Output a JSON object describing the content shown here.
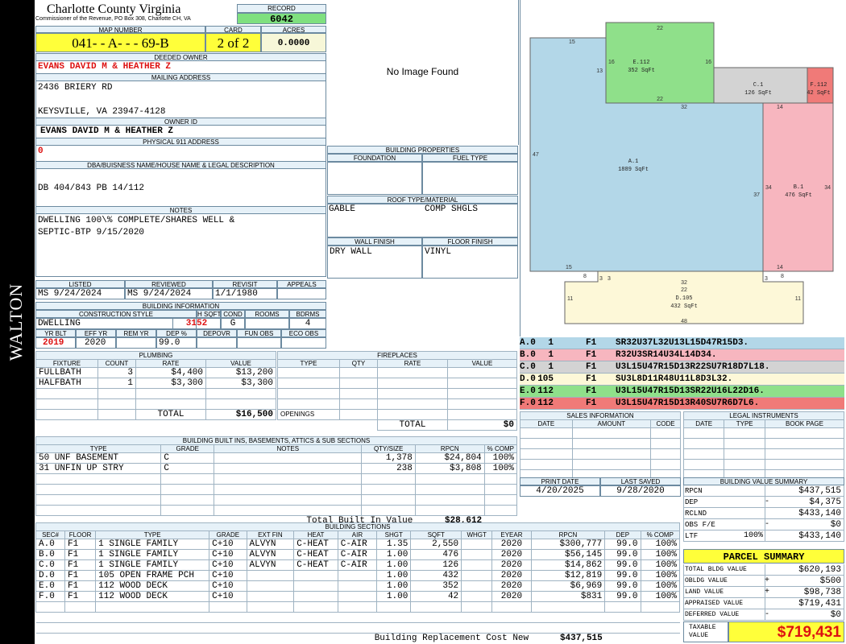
{
  "sidebar": {
    "district": "WALTON"
  },
  "header": {
    "county_title": "Charlotte County Virginia",
    "county_sub": "Commissioner of the Revenue, PO Box 308, Charlotte CH, VA",
    "record_label": "RECORD",
    "record_value": "6042",
    "map_label": "MAP NUMBER",
    "map_value": "041- - A- - - 69-B",
    "card_label": "CARD",
    "card_value": "2 of 2",
    "acres_label": "ACRES",
    "acres_value": "0.0000"
  },
  "owner": {
    "deeded_label": "DEEDED OWNER",
    "deeded_value": "EVANS DAVID M & HEATHER Z",
    "mailing_label": "MAILING ADDRESS",
    "mailing_line1": "2436 BRIERY RD",
    "mailing_line2": "KEYSVILLE, VA 23947-4128",
    "owner_id_label": "OWNER ID",
    "owner_id_value": "EVANS DAVID M & HEATHER Z",
    "physical_label": "PHYSICAL 911 ADDRESS",
    "physical_value": "0",
    "dba_label": "DBA/BUISNESS NAME/HOUSE NAME & LEGAL DESCRIPTION",
    "dba_value": "DB 404/843 PB 14/112",
    "notes_label": "NOTES",
    "notes_line1": "DWELLING 100\\% COMPLETE/SHARES WELL &",
    "notes_line2": "SEPTIC-BTP 9/15/2020"
  },
  "image": {
    "placeholder": "No Image Found"
  },
  "building_properties": {
    "title": "BUILDING PROPERTIES",
    "foundation_label": "FOUNDATION",
    "foundation_value": "",
    "fuel_label": "FUEL TYPE",
    "fuel_value": "",
    "roof_label": "ROOF TYPE/MATERIAL",
    "roof_type": "GABLE",
    "roof_material": "COMP SHGLS",
    "wall_label": "WALL FINISH",
    "wall_value": "DRY WALL",
    "floor_label": "FLOOR FINISH",
    "floor_value": "VINYL"
  },
  "dates": {
    "listed_label": "LISTED",
    "listed_value": "MS 9/24/2024",
    "reviewed_label": "REVIEWED",
    "reviewed_value": "MS 9/24/2024",
    "revisit_label": "REVISIT",
    "revisit_value": "1/1/1980",
    "appeals_label": "APPEALS",
    "appeals_value": ""
  },
  "building_info": {
    "title": "BUILDING INFORMATION",
    "style_label": "CONSTRUCTION STYLE",
    "style_value": "DWELLING",
    "hsqft_label": "H SQFT",
    "hsqft_value": "3152",
    "cond_label": "COND",
    "cond_value": "G",
    "rooms_label": "ROOMS",
    "rooms_value": "",
    "bdrms_label": "BDRMS",
    "bdrms_value": "4",
    "yrblt_label": "YR BLT",
    "yrblt_value": "2019",
    "effyr_label": "EFF YR",
    "effyr_value": "2020",
    "remyr_label": "REM YR",
    "remyr_value": "",
    "dep_label": "DEP %",
    "dep_value": "99.0",
    "depovr_label": "DEPOVR",
    "depovr_value": "",
    "funobs_label": "FUN OBS",
    "funobs_value": "",
    "ecoobs_label": "ECO OBS",
    "ecoobs_value": ""
  },
  "plumbing": {
    "title": "PLUMBING",
    "headers": [
      "FIXTURE",
      "COUNT",
      "RATE",
      "VALUE"
    ],
    "rows": [
      [
        "FULLBATH",
        "3",
        "$4,400",
        "$13,200"
      ],
      [
        "HALFBATH",
        "1",
        "$3,300",
        "$3,300"
      ]
    ],
    "total_label": "TOTAL",
    "total_value": "$16,500"
  },
  "fireplaces": {
    "title": "FIREPLACES",
    "headers": [
      "TYPE",
      "QTY",
      "RATE",
      "VALUE"
    ],
    "openings_label": "OPENINGS",
    "total_label": "TOTAL",
    "total_value": "$0"
  },
  "builtins": {
    "title": "BUILDING BUILT INS, BASEMENTS, ATTICS & SUB SECTIONS",
    "headers": [
      "TYPE",
      "GRADE",
      "NOTES",
      "QTY/SIZE",
      "RPCN",
      "% COMP"
    ],
    "rows": [
      [
        "50 UNF BASEMENT",
        "C",
        "",
        "1,378",
        "$24,804",
        "100%"
      ],
      [
        "31 UNFIN UP STRY",
        "C",
        "",
        "238",
        "$3,808",
        "100%"
      ]
    ],
    "total_label": "Total Built In Value",
    "total_value": "$28,612"
  },
  "sections": {
    "title": "BUILDING SECTIONS",
    "headers": [
      "SEC#",
      "FLOOR",
      "TYPE",
      "GRADE",
      "EXT FIN",
      "HEAT",
      "AIR",
      "SHGT",
      "SQFT",
      "WHGT",
      "EYEAR",
      "RPCN",
      "DEP",
      "% COMP"
    ],
    "rows": [
      [
        "A.0",
        "F1",
        "1 SINGLE FAMILY",
        "C+10",
        "ALVYN",
        "C-HEAT",
        "C-AIR",
        "1.35",
        "2,550",
        "",
        "2020",
        "$300,777",
        "99.0",
        "100%"
      ],
      [
        "B.0",
        "F1",
        "1 SINGLE FAMILY",
        "C+10",
        "ALVYN",
        "C-HEAT",
        "C-AIR",
        "1.00",
        "476",
        "",
        "2020",
        "$56,145",
        "99.0",
        "100%"
      ],
      [
        "C.0",
        "F1",
        "1 SINGLE FAMILY",
        "C+10",
        "ALVYN",
        "C-HEAT",
        "C-AIR",
        "1.00",
        "126",
        "",
        "2020",
        "$14,862",
        "99.0",
        "100%"
      ],
      [
        "D.0",
        "F1",
        "105 OPEN FRAME PCH",
        "C+10",
        "",
        "",
        "",
        "1.00",
        "432",
        "",
        "2020",
        "$12,819",
        "99.0",
        "100%"
      ],
      [
        "E.0",
        "F1",
        "112 WOOD DECK",
        "C+10",
        "",
        "",
        "",
        "1.00",
        "352",
        "",
        "2020",
        "$6,969",
        "99.0",
        "100%"
      ],
      [
        "F.0",
        "F1",
        "112 WOOD DECK",
        "C+10",
        "",
        "",
        "",
        "1.00",
        "42",
        "",
        "2020",
        "$831",
        "99.0",
        "100%"
      ]
    ],
    "replacement_label": "Building Replacement Cost New",
    "replacement_value": "$437,515"
  },
  "sketch": {
    "areas": [
      {
        "name": "A.1",
        "sqft": "1889 SqFt",
        "color": "#b3d7e8"
      },
      {
        "name": "B.1",
        "sqft": "476 SqFt",
        "color": "#f7b6bf"
      },
      {
        "name": "C.1",
        "sqft": "126 SqFt",
        "color": "#d3d3d3"
      },
      {
        "name": "D.105",
        "sqft": "432 SqFt",
        "color": "#fdf8d8"
      },
      {
        "name": "E.112",
        "sqft": "352 SqFt",
        "color": "#8fe08a"
      },
      {
        "name": "F.112",
        "sqft": "42 SqFt",
        "color": "#f07a78"
      }
    ],
    "dims": {
      "a_top": "15",
      "a_left": "47",
      "a_bottom": "15",
      "a_mid_bottom": "32",
      "a_right": "37",
      "e_top": "22",
      "e_left": "16",
      "e_right": "16",
      "e_bottom": "22",
      "e_left2": "13",
      "a_top_right": "32",
      "b_top": "14",
      "b_left": "34",
      "b_right": "34",
      "b_bottom": "14",
      "d_top": "32",
      "d_bottom": "48",
      "d_left": "11",
      "d_right": "11",
      "d_notch_l": "8",
      "d_notch_l2": "3",
      "d_notch_r": "3",
      "d_notch_r2": "8",
      "d_top2": "22"
    },
    "legend": [
      {
        "code": "A.0",
        "num": "1",
        "floor": "F1",
        "path": "SR32U37L32U13L15D47R15D3.",
        "color": "#b3d7e8"
      },
      {
        "code": "B.0",
        "num": "1",
        "floor": "F1",
        "path": "R32U3SR14U34L14D34.",
        "color": "#f7b6bf"
      },
      {
        "code": "C.0",
        "num": "1",
        "floor": "F1",
        "path": "U3L15U47R15D13R22SU7R18D7L18.",
        "color": "#d3d3d3"
      },
      {
        "code": "D.0",
        "num": "105",
        "floor": "F1",
        "path": "SU3L8D11R48U11L8D3L32.",
        "color": "#fdf8d8"
      },
      {
        "code": "E.0",
        "num": "112",
        "floor": "F1",
        "path": "U3L15U47R15D13SR22U16L22D16.",
        "color": "#8fe08a"
      },
      {
        "code": "F.0",
        "num": "112",
        "floor": "F1",
        "path": "U3L15U47R15D13R40SU7R6D7L6.",
        "color": "#f07a78"
      }
    ]
  },
  "sales": {
    "title": "SALES INFORMATION",
    "headers": [
      "DATE",
      "AMOUNT",
      "CODE"
    ]
  },
  "legal": {
    "title": "LEGAL INSTRUMENTS",
    "headers": [
      "DATE",
      "TYPE",
      "BOOK PAGE"
    ]
  },
  "print": {
    "print_label": "PRINT DATE",
    "print_value": "4/20/2025",
    "saved_label": "LAST SAVED",
    "saved_value": "9/28/2020"
  },
  "value_summary": {
    "title": "BUILDING VALUE SUMMARY",
    "rows": [
      {
        "label": "RPCN",
        "sign": "",
        "value": "$437,515"
      },
      {
        "label": "DEP",
        "sign": "-",
        "value": "$4,375"
      },
      {
        "label": "RCLND",
        "sign": "",
        "value": "$433,140"
      },
      {
        "label": "OBS F/E",
        "sign": "-",
        "value": "$0"
      },
      {
        "label": "LTF",
        "sign": "100%",
        "value": "$433,140"
      }
    ]
  },
  "parcel": {
    "title": "PARCEL SUMMARY",
    "rows": [
      {
        "label": "TOTAL BLDG VALUE",
        "sign": "",
        "value": "$620,193"
      },
      {
        "label": "OBLDG VALUE",
        "sign": "+",
        "value": "$500"
      },
      {
        "label": "LAND VALUE",
        "sign": "+",
        "value": "$98,738"
      },
      {
        "label": "APPRAISED VALUE",
        "sign": "",
        "value": "$719,431"
      },
      {
        "label": "DEFERRED VALUE",
        "sign": "-",
        "value": "$0"
      }
    ],
    "taxable_label_1": "TAXABLE",
    "taxable_label_2": "VALUE",
    "taxable_value": "$719,431"
  }
}
